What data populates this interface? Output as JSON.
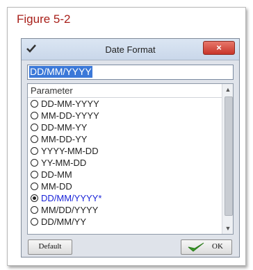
{
  "figure": {
    "label": "Figure 5-2"
  },
  "dialog": {
    "title": "Date Format",
    "close_label": "×",
    "value": "DD/MM/YYYY",
    "list_header": "Parameter",
    "options": [
      "DD-MM-YYYY",
      "MM-DD-YYYY",
      "DD-MM-YY",
      "MM-DD-YY",
      "YYYY-MM-DD",
      "YY-MM-DD",
      "DD-MM",
      "MM-DD",
      "DD/MM/YYYY*",
      "MM/DD/YYYY",
      "DD/MM/YY"
    ],
    "selected_index": 8,
    "default_label": "Default",
    "ok_label": "OK"
  },
  "colors": {
    "figure_label": "#a8201a",
    "selected_option": "#1a24d8",
    "close_button": "#c8352a",
    "ok_check": "#3a9a2a"
  }
}
